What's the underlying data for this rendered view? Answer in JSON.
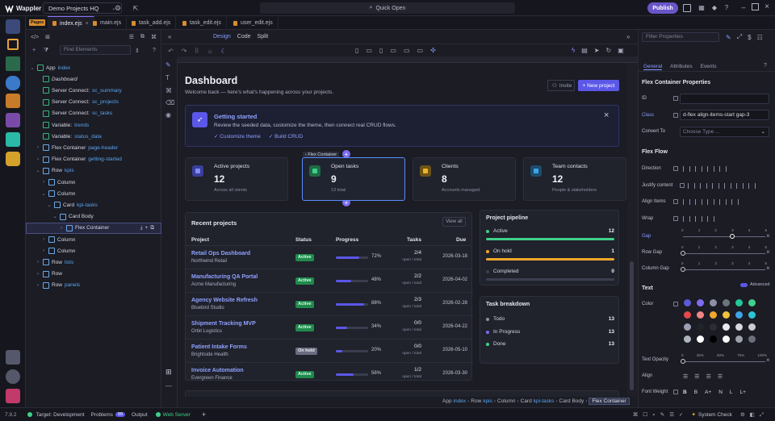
{
  "app": {
    "name": "Wappler",
    "project": "Demo Projects HQ",
    "quick_open": "Quick Open",
    "publish": "Publish"
  },
  "tabs": {
    "pages_label": "Pages",
    "files": [
      {
        "label": "index.ejs",
        "active": true
      },
      {
        "label": "main.ejs",
        "active": false
      },
      {
        "label": "task_add.ejs",
        "active": false
      },
      {
        "label": "task_edit.ejs",
        "active": false
      },
      {
        "label": "user_edit.ejs",
        "active": false
      }
    ]
  },
  "structure": {
    "find_placeholder": "Find Elements",
    "nodes": [
      {
        "label": "App",
        "cls": "index",
        "depth": 0,
        "chev": "v"
      },
      {
        "label": "Dashboard",
        "cls": "",
        "depth": 1,
        "chev": "",
        "italic": true
      },
      {
        "label": "Server Connect:",
        "cls": "sc_summary",
        "depth": 1,
        "chev": ""
      },
      {
        "label": "Server Connect:",
        "cls": "sc_projects",
        "depth": 1,
        "chev": ""
      },
      {
        "label": "Server Connect:",
        "cls": "sc_tasks",
        "depth": 1,
        "chev": ""
      },
      {
        "label": "Variable:",
        "cls": "trends",
        "depth": 1,
        "chev": ""
      },
      {
        "label": "Variable:",
        "cls": "status_data",
        "depth": 1,
        "chev": ""
      },
      {
        "label": "Flex Container",
        "cls": "page-header",
        "depth": 1,
        "chev": ">"
      },
      {
        "label": "Flex Container",
        "cls": "getting-started",
        "depth": 1,
        "chev": ">"
      },
      {
        "label": "Row",
        "cls": "kpis",
        "depth": 1,
        "chev": "v"
      },
      {
        "label": "Column",
        "cls": "",
        "depth": 2,
        "chev": ">"
      },
      {
        "label": "Column",
        "cls": "",
        "depth": 2,
        "chev": "v"
      },
      {
        "label": "Card",
        "cls": "kpi-tasks",
        "depth": 3,
        "chev": "v"
      },
      {
        "label": "Card Body",
        "cls": "",
        "depth": 4,
        "chev": "v"
      },
      {
        "label": "Flex Container",
        "cls": "",
        "depth": 5,
        "chev": ">",
        "selected": true
      },
      {
        "label": "Column",
        "cls": "",
        "depth": 2,
        "chev": ">"
      },
      {
        "label": "Column",
        "cls": "",
        "depth": 2,
        "chev": ">"
      },
      {
        "label": "Row",
        "cls": "lists",
        "depth": 1,
        "chev": ">"
      },
      {
        "label": "Row",
        "cls": "",
        "depth": 1,
        "chev": ">"
      },
      {
        "label": "Row",
        "cls": "panels",
        "depth": 1,
        "chev": ">"
      }
    ]
  },
  "design": {
    "modes": [
      "Design",
      "Code",
      "Split"
    ],
    "active_mode": "Design"
  },
  "dashboard": {
    "title": "Dashboard",
    "subtitle": "Welcome back — here's what's happening across your projects.",
    "invite": "Invite",
    "new_project": "+ New project",
    "getting_started": {
      "title": "Getting started",
      "text": "Review the seeded data, customize the theme, then connect real CRUD flows.",
      "check1": "Customize theme",
      "check2": "Build CRUD"
    },
    "selected_tag": "Flex Container",
    "stats": [
      {
        "title": "Active projects",
        "value": "12",
        "sub": "Across all clients",
        "color": "#3b3f9a",
        "icon_color": "#7f8cff"
      },
      {
        "title": "Open tasks",
        "value": "9",
        "sub": "13 total",
        "color": "#1f6b45",
        "icon_color": "#3fd08a"
      },
      {
        "title": "Clients",
        "value": "8",
        "sub": "Accounts managed",
        "color": "#6b5417",
        "icon_color": "#f0b429"
      },
      {
        "title": "Team contacts",
        "value": "12",
        "sub": "People & stakeholders",
        "color": "#1c4d6b",
        "icon_color": "#3fa3e6"
      }
    ],
    "projects": {
      "title": "Recent projects",
      "view_all": "View all",
      "headers": [
        "Project",
        "Status",
        "Progress",
        "Tasks",
        "Due"
      ],
      "rows": [
        {
          "name": "Retail Ops Dashboard",
          "org": "Northwind Retail",
          "status": "Active",
          "progress": 72,
          "pct": "72%",
          "tasks": "2/4",
          "tasks_sub": "open / total",
          "due": "2026-03-18"
        },
        {
          "name": "Manufacturing QA Portal",
          "org": "Acme Manufacturing",
          "status": "Active",
          "progress": 48,
          "pct": "48%",
          "tasks": "2/2",
          "tasks_sub": "open / total",
          "due": "2026-04-02"
        },
        {
          "name": "Agency Website Refresh",
          "org": "Bluebird Studio",
          "status": "Active",
          "progress": 88,
          "pct": "88%",
          "tasks": "2/3",
          "tasks_sub": "open / total",
          "due": "2026-02-28"
        },
        {
          "name": "Shipment Tracking MVP",
          "org": "Orbit Logistics",
          "status": "Active",
          "progress": 34,
          "pct": "34%",
          "tasks": "0/0",
          "tasks_sub": "open / total",
          "due": "2026-04-22"
        },
        {
          "name": "Patient Intake Forms",
          "org": "Brightside Health",
          "status": "On hold",
          "progress": 20,
          "pct": "20%",
          "tasks": "0/0",
          "tasks_sub": "open / total",
          "due": "2026-05-10"
        },
        {
          "name": "Invoice Automation",
          "org": "Evergreen Finance",
          "status": "Active",
          "progress": 56,
          "pct": "56%",
          "tasks": "1/2",
          "tasks_sub": "open / total",
          "due": "2026-03-30"
        }
      ]
    },
    "pipeline": {
      "title": "Project pipeline",
      "items": [
        {
          "label": "Active",
          "count": "12",
          "color": "#3fd08a",
          "fill": 1.0
        },
        {
          "label": "On hold",
          "count": "1",
          "color": "#f0a82a",
          "fill": 1.0
        },
        {
          "label": "Completed",
          "count": "0",
          "color": "#3c3f4f",
          "fill": 0
        }
      ]
    },
    "breakdown": {
      "title": "Task breakdown",
      "items": [
        {
          "label": "Todo",
          "count": "13",
          "color": "#8d90a4"
        },
        {
          "label": "In Progress",
          "count": "13",
          "color": "#7c6cf0"
        },
        {
          "label": "Done",
          "count": "13",
          "color": "#3fd08a"
        }
      ]
    }
  },
  "breadcrumb": [
    "App",
    "index",
    "Row",
    "kpis",
    "Column",
    "Card",
    "kpi-tasks",
    "Card Body",
    "Flex Container"
  ],
  "properties": {
    "filter_placeholder": "Filter Properties",
    "tabs": [
      "General",
      "Attributes",
      "Events"
    ],
    "section_title": "Flex Container Properties",
    "id_label": "ID",
    "id_value": "",
    "class_label": "Class",
    "class_value": "d-flex align-items-start gap-3",
    "convert_label": "Convert To",
    "convert_placeholder": "Choose Type ...",
    "flex_flow": "Flex Flow",
    "direction": "Direction",
    "justify": "Justify content",
    "align_items": "Align Items",
    "wrap": "Wrap",
    "gap": "Gap",
    "row_gap": "Row Gap",
    "column_gap": "Column Gap",
    "gap_ticks": [
      "0",
      "1",
      "2",
      "3",
      "4",
      "5"
    ],
    "gap_value": 3,
    "text_section": "Text",
    "advanced": "Advanced",
    "color_label": "Color",
    "opacity_label": "Text Opacity",
    "opacity_ticks": [
      "0",
      "25%",
      "50%",
      "75%",
      "100%"
    ],
    "align_label": "Align",
    "weight_label": "Font Weight",
    "weight_options": [
      "B",
      "B",
      "A+",
      "N",
      "L",
      "L+"
    ],
    "swatches": [
      "#5b5bd6",
      "#7c6cf0",
      "#8d90a4",
      "#6c757d",
      "#20c997",
      "#3fd08a",
      "#e5484d",
      "#f08585",
      "#f0a82a",
      "#f0c23b",
      "#3fa3e6",
      "#2cc4d4",
      "#9aa0b4",
      "#212529",
      "#2b2d36",
      "#e9ecef",
      "#d7d9e0",
      "#c9ccd6",
      "#adb5bd",
      "#ffffff",
      "#000000",
      "#f8f9fa",
      "#9ea2ad",
      "#6b6f7c"
    ]
  },
  "status": {
    "version": "7.9.2",
    "target": "Target: Development",
    "problems": "Problems",
    "problems_count": "99",
    "output": "Output",
    "web_server": "Web Server",
    "system_check": "System Check"
  }
}
